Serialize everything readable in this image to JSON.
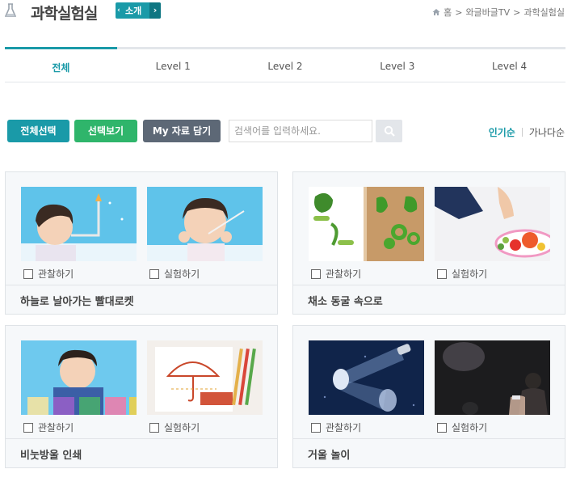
{
  "header": {
    "title": "과학실험실",
    "intro_button": "소개",
    "breadcrumb": [
      "홈",
      "와글바글TV",
      "과학실험실"
    ]
  },
  "tabs": [
    {
      "label": "전체",
      "active": true
    },
    {
      "label": "Level 1",
      "active": false
    },
    {
      "label": "Level 2",
      "active": false
    },
    {
      "label": "Level 3",
      "active": false
    },
    {
      "label": "Level 4",
      "active": false
    }
  ],
  "toolbar": {
    "select_all": "전체선택",
    "view_selected": "선택보기",
    "add_to_my": "My 자료 담기",
    "search_placeholder": "검색어를 입력하세요.",
    "sort_popular": "인기순",
    "sort_alpha": "가나다순"
  },
  "colors": {
    "accent": "#1a9aa8",
    "green": "#2fb56b",
    "slate": "#5d6876"
  },
  "cards": [
    {
      "title": "하늘로 날아가는 빨대로켓",
      "checks": [
        "관찰하기",
        "실험하기"
      ]
    },
    {
      "title": "채소 동굴 속으로",
      "checks": [
        "관찰하기",
        "실험하기"
      ]
    },
    {
      "title": "비눗방울 인쇄",
      "checks": [
        "관찰하기",
        "실험하기"
      ]
    },
    {
      "title": "거울 놀이",
      "checks": [
        "관찰하기",
        "실험하기"
      ]
    }
  ]
}
